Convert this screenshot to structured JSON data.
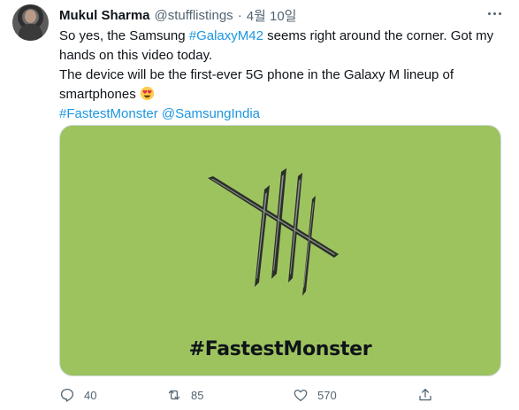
{
  "author": {
    "name": "Mukul Sharma",
    "handle": "@stufflistings",
    "separator": "·",
    "date": "4월 10일"
  },
  "tweet": {
    "line1_pre": "So yes, the Samsung ",
    "line1_hashtag": "#GalaxyM42",
    "line1_post": " seems right around the corner. Got my hands on this video today.",
    "line2": "The device will be the first-ever 5G phone in the Galaxy M lineup of smartphones",
    "hashtag": "#FastestMonster",
    "mention": "@SamsungIndia"
  },
  "media": {
    "caption": "#FastestMonster",
    "background_color": "#9dc35f"
  },
  "actions": {
    "reply_count": "40",
    "retweet_count": "85",
    "like_count": "570"
  },
  "icons": {
    "reply": "reply-icon",
    "retweet": "retweet-icon",
    "like": "heart-icon",
    "share": "share-icon",
    "more": "more-icon"
  },
  "colors": {
    "link": "#1b95e0",
    "secondary_text": "#536471"
  }
}
